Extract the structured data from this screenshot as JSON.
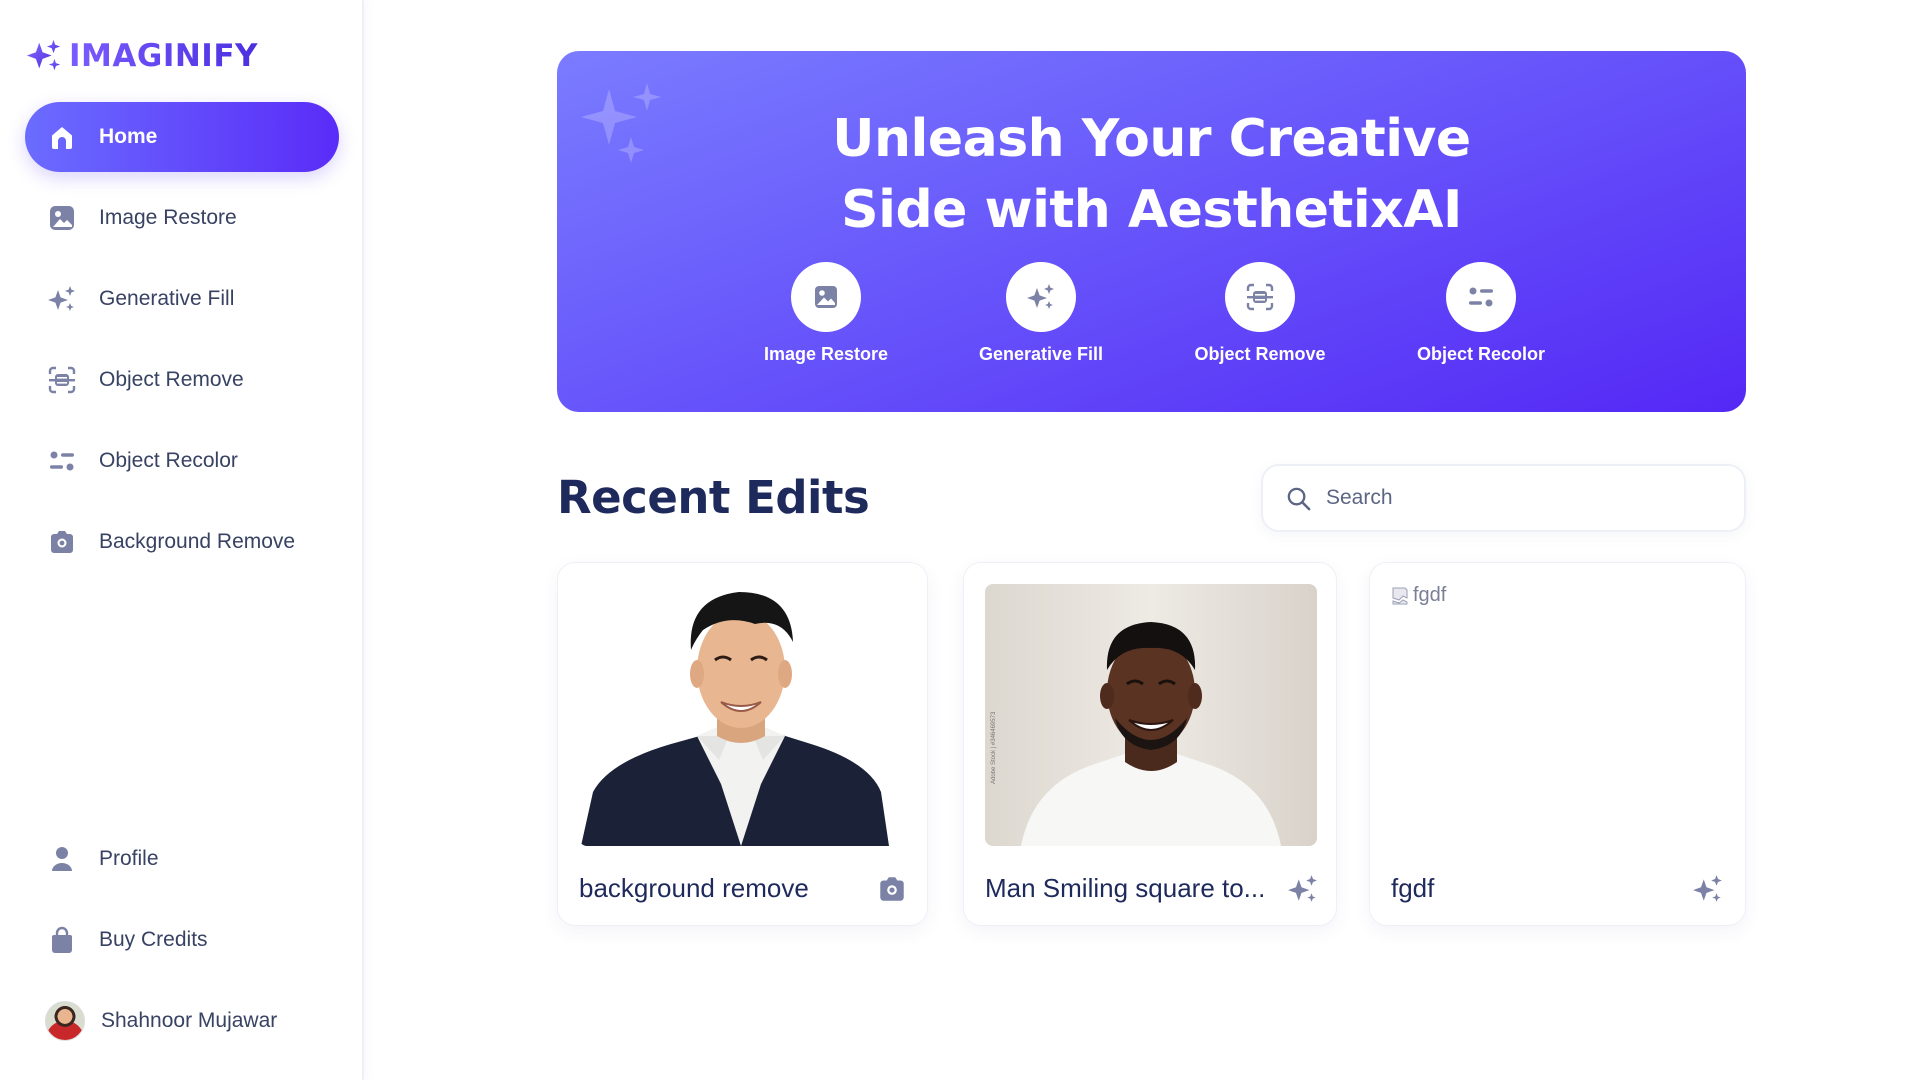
{
  "app": {
    "logo_text": "IMAGINIFY"
  },
  "sidebar": {
    "items": [
      {
        "label": "Home",
        "icon": "home-icon"
      },
      {
        "label": "Image Restore",
        "icon": "image-icon"
      },
      {
        "label": "Generative Fill",
        "icon": "sparkles-icon"
      },
      {
        "label": "Object Remove",
        "icon": "scan-icon"
      },
      {
        "label": "Object Recolor",
        "icon": "filter-icon"
      },
      {
        "label": "Background Remove",
        "icon": "camera-icon"
      }
    ],
    "bottom_items": [
      {
        "label": "Profile",
        "icon": "user-icon"
      },
      {
        "label": "Buy Credits",
        "icon": "bag-icon"
      }
    ],
    "user": {
      "name": "Shahnoor Mujawar"
    }
  },
  "banner": {
    "title_line1": "Unleash Your Creative",
    "title_line2": "Side with AesthetixAI",
    "tools": [
      {
        "label": "Image Restore",
        "icon": "image-icon"
      },
      {
        "label": "Generative Fill",
        "icon": "sparkles-icon"
      },
      {
        "label": "Object Remove",
        "icon": "scan-icon"
      },
      {
        "label": "Object Recolor",
        "icon": "filter-icon"
      }
    ]
  },
  "recent": {
    "title": "Recent Edits",
    "search_placeholder": "Search",
    "cards": [
      {
        "title": "background remove",
        "icon": "camera-icon"
      },
      {
        "title": "Man Smiling square to...",
        "icon": "sparkles-icon"
      },
      {
        "title": "fgdf",
        "icon": "sparkles-icon",
        "alt_text": "fgdf"
      }
    ]
  },
  "colors": {
    "accent": "#5a2cf8",
    "accent_light": "#7a7cff",
    "text_dark": "#1f2a5c",
    "text": "#384262",
    "icon_gray": "#7c82a6"
  }
}
